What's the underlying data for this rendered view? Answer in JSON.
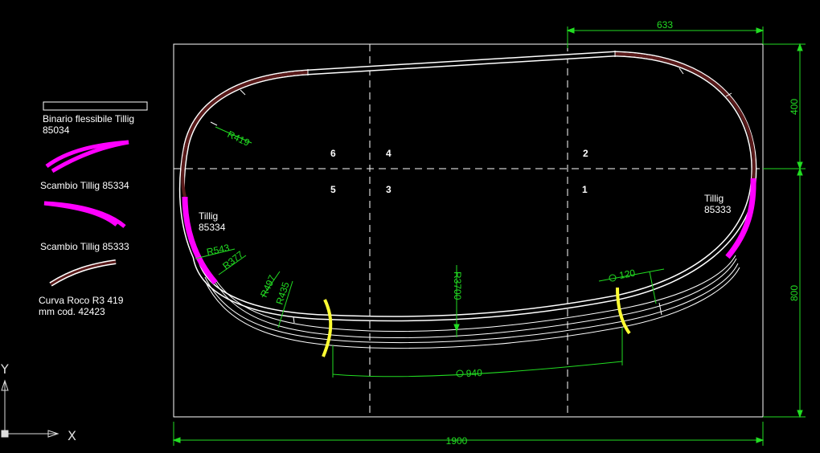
{
  "colors": {
    "background": "#000000",
    "frame": "#ffffff",
    "dimension": "#22dd22",
    "track": "#ffffff",
    "roco_curve": "#5a1a1a",
    "tillig_switch": "#ff00ff",
    "insulated_joint": "#ffff33"
  },
  "legend": {
    "flex_track_label": "Binario flessibile Tillig\n85034",
    "switch_85334_label": "Scambio Tillig 85334",
    "switch_85333_label": "Scambio Tillig 85333",
    "roco_curve_label": "Curva Roco R3 419\nmm cod. 42423"
  },
  "sections": {
    "s1": "1",
    "s2": "2",
    "s3": "3",
    "s4": "4",
    "s5": "5",
    "s6": "6"
  },
  "switch_labels": {
    "left": "Tillig\n85334",
    "right": "Tillig\n85333"
  },
  "dimensions": {
    "overall_width": "1900",
    "top_right_width": "633",
    "upper_height": "400",
    "lower_height": "800",
    "r419": "R419",
    "r543": "R543",
    "r377": "R377",
    "r497": "R497",
    "r435": "R435",
    "r3700": "R3700",
    "spacing_120": "120",
    "arc_940": "940"
  },
  "axes": {
    "y_label": "Y",
    "x_label": "X"
  }
}
